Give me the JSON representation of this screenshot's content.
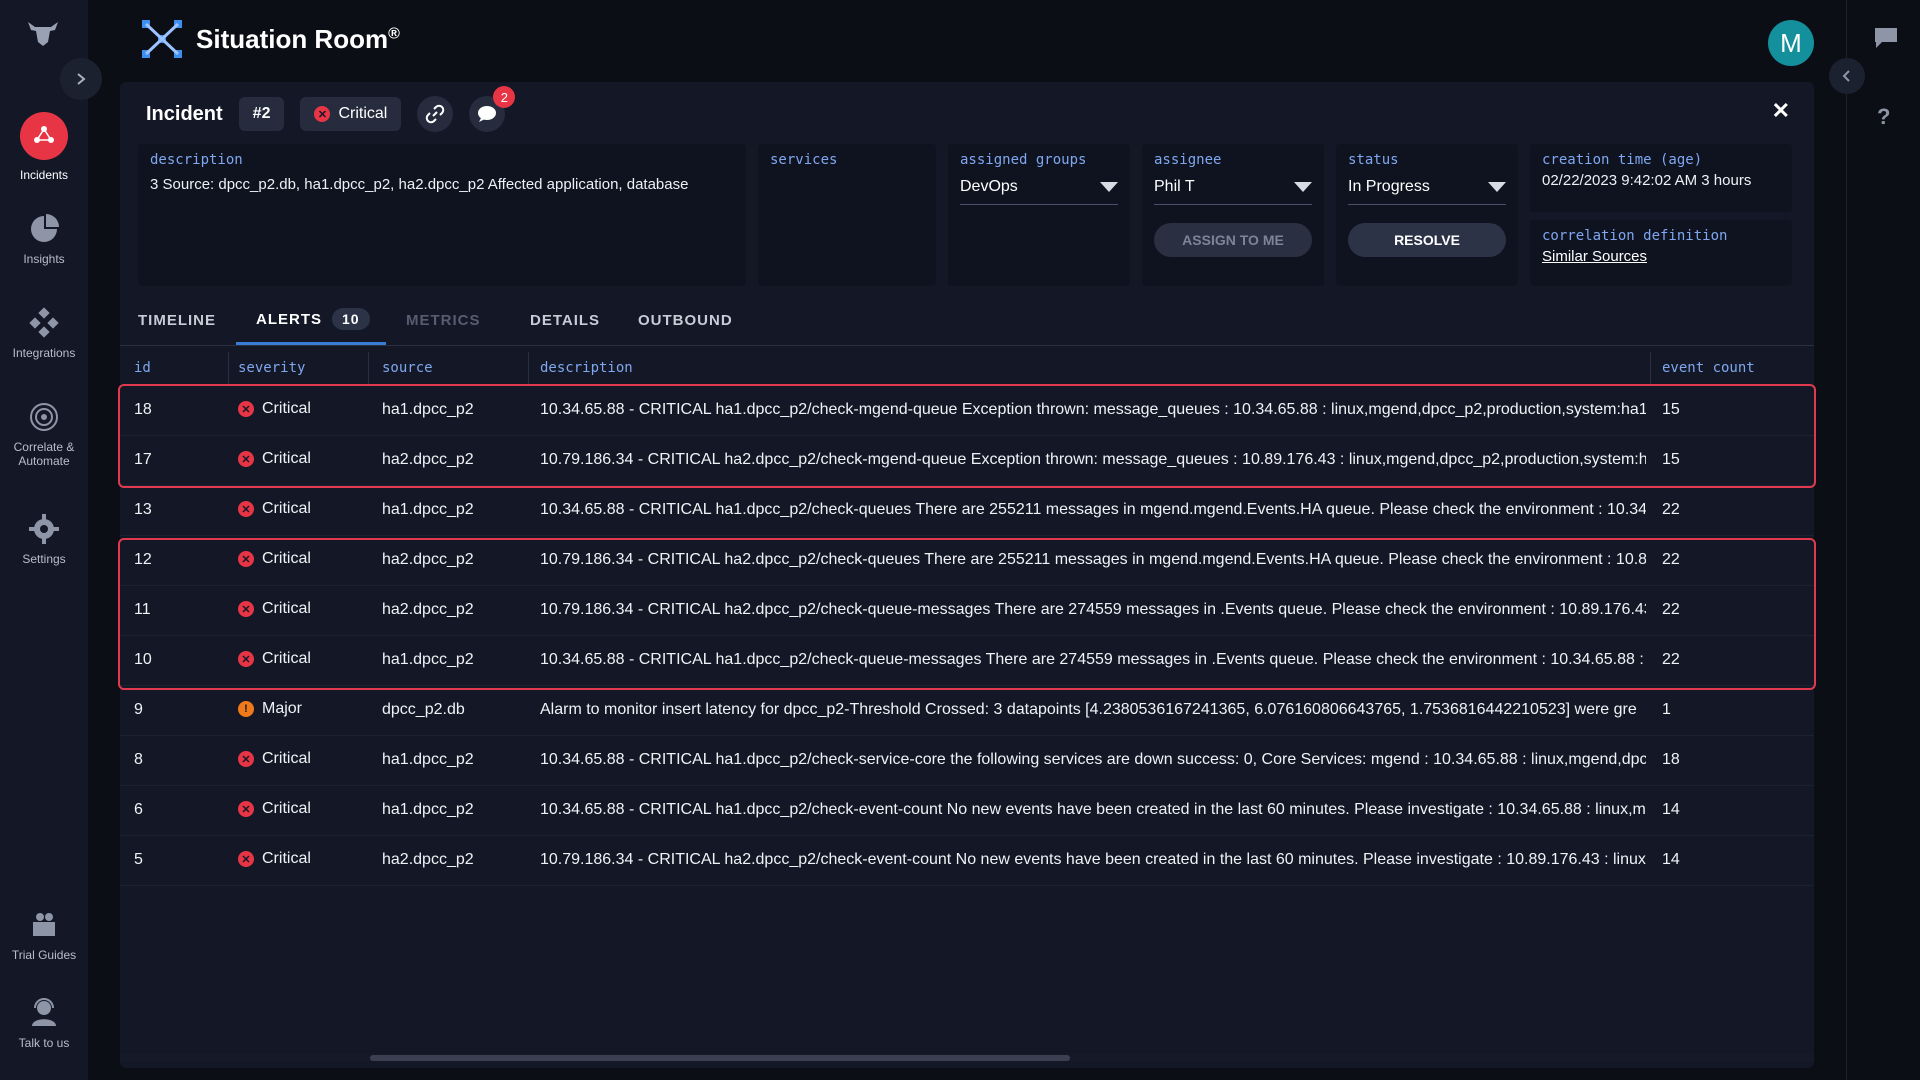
{
  "app": {
    "title": "Situation Room",
    "trademark": "®",
    "avatar_initial": "M"
  },
  "nav": [
    {
      "label": "Incidents",
      "icon": "incidents-icon",
      "active": true
    },
    {
      "label": "Insights",
      "icon": "pie-chart-icon"
    },
    {
      "label": "Integrations",
      "icon": "integrations-icon"
    },
    {
      "label": "Correlate &",
      "label2": "Automate",
      "icon": "target-icon"
    },
    {
      "label": "Settings",
      "icon": "gear-icon"
    },
    {
      "label": "Trial Guides",
      "icon": "guides-icon"
    },
    {
      "label": "Talk to us",
      "icon": "support-agent-icon"
    }
  ],
  "incident": {
    "label": "Incident",
    "number": "#2",
    "severity": "Critical",
    "comment_count": "2"
  },
  "fields": {
    "description": {
      "label": "description",
      "value": "3 Source: dpcc_p2.db, ha1.dpcc_p2, ha2.dpcc_p2 Affected application, database"
    },
    "services": {
      "label": "services"
    },
    "assigned_groups": {
      "label": "assigned groups",
      "value": "DevOps"
    },
    "assignee": {
      "label": "assignee",
      "value": "Phil T",
      "button": "ASSIGN TO ME"
    },
    "status": {
      "label": "status",
      "value": "In Progress",
      "button": "RESOLVE"
    },
    "creation_time": {
      "label": "creation time (age)",
      "value": "02/22/2023 9:42:02 AM 3 hours"
    },
    "correlation": {
      "label": "correlation definition",
      "value": "Similar Sources"
    }
  },
  "tabs": [
    {
      "label": "TIMELINE"
    },
    {
      "label": "ALERTS",
      "count": "10",
      "active": true
    },
    {
      "label": "METRICS",
      "disabled": true
    },
    {
      "label": "DETAILS"
    },
    {
      "label": "OUTBOUND"
    }
  ],
  "table": {
    "columns": [
      "id",
      "severity",
      "source",
      "description",
      "event count"
    ],
    "rows": [
      {
        "id": "18",
        "severity": "Critical",
        "source": "ha1.dpcc_p2",
        "description": "10.34.65.88 - CRITICAL ha1.dpcc_p2/check-mgend-queue Exception thrown: message_queues : 10.34.65.88 : linux,mgend,dpcc_p2,production,system:ha1",
        "count": "15"
      },
      {
        "id": "17",
        "severity": "Critical",
        "source": "ha2.dpcc_p2",
        "description": "10.79.186.34 - CRITICAL ha2.dpcc_p2/check-mgend-queue Exception thrown: message_queues : 10.89.176.43 : linux,mgend,dpcc_p2,production,system:h",
        "count": "15"
      },
      {
        "id": "13",
        "severity": "Critical",
        "source": "ha1.dpcc_p2",
        "description": "10.34.65.88 - CRITICAL ha1.dpcc_p2/check-queues There are 255211 messages in mgend.mgend.Events.HA queue. Please check the environment : 10.34",
        "count": "22"
      },
      {
        "id": "12",
        "severity": "Critical",
        "source": "ha2.dpcc_p2",
        "description": "10.79.186.34 - CRITICAL ha2.dpcc_p2/check-queues There are 255211 messages in mgend.mgend.Events.HA queue. Please check the environment : 10.8",
        "count": "22"
      },
      {
        "id": "11",
        "severity": "Critical",
        "source": "ha2.dpcc_p2",
        "description": "10.79.186.34 - CRITICAL ha2.dpcc_p2/check-queue-messages There are 274559 messages in .Events queue. Please check the environment : 10.89.176.43",
        "count": "22"
      },
      {
        "id": "10",
        "severity": "Critical",
        "source": "ha1.dpcc_p2",
        "description": "10.34.65.88 - CRITICAL ha1.dpcc_p2/check-queue-messages There are 274559 messages in .Events queue. Please check the environment : 10.34.65.88 : l",
        "count": "22"
      },
      {
        "id": "9",
        "severity": "Major",
        "source": "dpcc_p2.db",
        "description": "Alarm to monitor insert latency for dpcc_p2-Threshold Crossed: 3 datapoints [4.2380536167241365, 6.076160806643765, 1.7536816442210523] were gre",
        "count": "1"
      },
      {
        "id": "8",
        "severity": "Critical",
        "source": "ha1.dpcc_p2",
        "description": "10.34.65.88 - CRITICAL ha1.dpcc_p2/check-service-core the following services are down success: 0, Core Services: mgend : 10.34.65.88 : linux,mgend,dpc",
        "count": "18"
      },
      {
        "id": "6",
        "severity": "Critical",
        "source": "ha1.dpcc_p2",
        "description": "10.34.65.88 - CRITICAL ha1.dpcc_p2/check-event-count No new events have been created in the last 60 minutes. Please investigate : 10.34.65.88 : linux,m",
        "count": "14"
      },
      {
        "id": "5",
        "severity": "Critical",
        "source": "ha2.dpcc_p2",
        "description": "10.79.186.34 - CRITICAL ha2.dpcc_p2/check-event-count No new events have been created in the last 60 minutes. Please investigate : 10.89.176.43 : linux",
        "count": "14"
      }
    ]
  },
  "colors": {
    "critical": "#e83545",
    "major": "#f07a1a",
    "accent": "#7fa7f0",
    "highlight": "#e03a4e"
  }
}
